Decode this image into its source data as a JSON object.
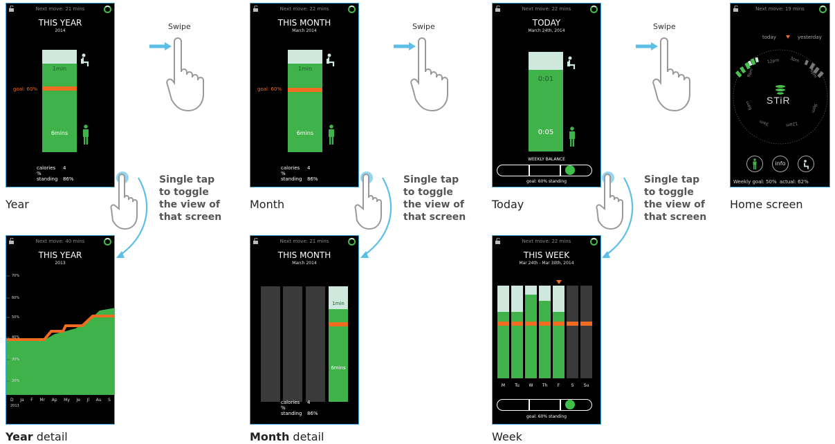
{
  "common": {
    "swipe": "Swipe",
    "tap_line1": "Single tap",
    "tap_line2": "to toggle",
    "tap_line3": "the view of",
    "tap_line4": "that screen"
  },
  "year": {
    "next": "Next move: 21 mins",
    "title": "THIS YEAR",
    "sub": "2014",
    "sit": "1min",
    "stand": "6mins",
    "goal": "goal: 60%",
    "calories_label": "calories",
    "calories": "4",
    "standing_label": "% standing",
    "standing": "86%",
    "caption": "Year"
  },
  "month": {
    "next": "Next move: 22 mins",
    "title": "THIS MONTH",
    "sub": "March 2014",
    "sit": "1min",
    "stand": "6mins",
    "goal": "goal: 60%",
    "calories_label": "calories",
    "calories": "4",
    "standing_label": "% standing",
    "standing": "86%",
    "caption": "Month"
  },
  "today": {
    "next": "Next move: 22 mins",
    "title": "TODAY",
    "sub": "March 24th, 2014",
    "sit": "0:01",
    "stand": "0:05",
    "balance_label": "WEEKLY BALANCE",
    "goal_text": "goal: 60% standing",
    "caption": "Today"
  },
  "home": {
    "next": "Next move: 19 mins",
    "today": "today",
    "yesterday": "yesterday",
    "logo": "STiR",
    "info": "info",
    "hours": [
      "12am",
      "3am",
      "6am",
      "9am",
      "12pm",
      "3pm",
      "6pm",
      "9pm"
    ],
    "footer": "Weekly goal: 50%  actual: 62%",
    "caption": "Home screen"
  },
  "year_detail": {
    "next": "Next move: 40 mins",
    "title": "THIS YEAR",
    "sub": "2013",
    "months": [
      "D",
      "Ja",
      "F",
      "Mr",
      "Ap",
      "My",
      "Je",
      "Jl",
      "Au",
      "S"
    ],
    "first_year": "2013",
    "ticks": [
      "70%",
      "60%",
      "50%",
      "40%",
      "30%",
      "20%"
    ],
    "caption_bold": "Year",
    "caption_rest": " detail"
  },
  "month_detail": {
    "next": "Next move: 21 mins",
    "title": "THIS MONTH",
    "sub": "March 2014",
    "sit": "1min",
    "stand": "6mins",
    "calories_label": "calories",
    "calories": "4",
    "standing_label": "% standing",
    "standing": "86%",
    "caption_bold": "Month",
    "caption_rest": " detail"
  },
  "week": {
    "next": "Next move: 22 mins",
    "title": "THIS WEEK",
    "sub": "Mar 24th - Mar 30th, 2014",
    "days": [
      "M",
      "Tu",
      "W",
      "Th",
      "F",
      "S",
      "Su"
    ],
    "goal_text": "goal: 60% standing",
    "caption": "Week"
  },
  "colors": {
    "green": "#3fb34a",
    "light": "#cfe8de",
    "goal": "#f26b21",
    "accent": "#3aa8dd",
    "dark_bar": "#3a3a3a"
  }
}
